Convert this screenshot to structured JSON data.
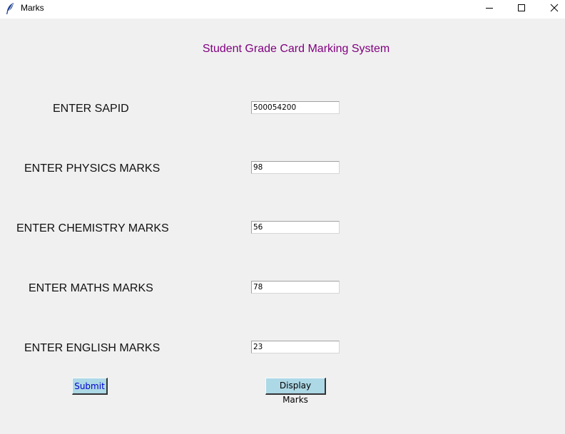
{
  "window": {
    "title": "Marks",
    "icon": "feather-icon",
    "controls": [
      "minimize-icon",
      "maximize-icon",
      "close-icon"
    ]
  },
  "form": {
    "heading": "Student Grade Card Marking System",
    "heading_color": "#800080",
    "fields": [
      {
        "label": "ENTER SAPID",
        "value": "500054200"
      },
      {
        "label": "ENTER PHYSICS MARKS",
        "value": "98"
      },
      {
        "label": "ENTER CHEMISTRY MARKS",
        "value": "56"
      },
      {
        "label": "ENTER MATHS MARKS",
        "value": "78"
      },
      {
        "label": "ENTER ENGLISH MARKS",
        "value": "23"
      }
    ],
    "submit_label": "Submit",
    "display_label": "Display Marks",
    "button_color": "#add8e6",
    "submit_text_color": "#0000cc"
  }
}
